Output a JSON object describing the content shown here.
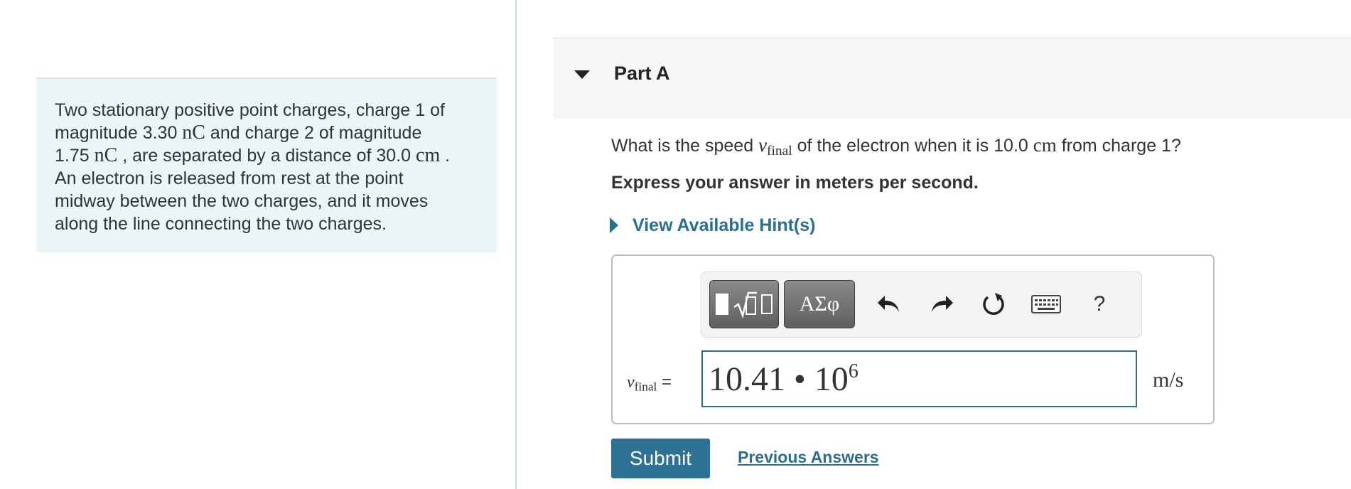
{
  "problem": {
    "line1": "Two stationary positive point charges, charge 1 of",
    "line2_a": "magnitude 3.30 ",
    "line2_unit": "nC",
    "line2_b": " and charge 2 of magnitude",
    "line3_a": "1.75 ",
    "line3_unit": "nC",
    "line3_b": " , are separated by a distance of 30.0 ",
    "line3_unit2": "cm",
    "line3_c": " .",
    "line4": "An electron is released from rest at the point",
    "line5": "midway between the two charges, and it moves",
    "line6": "along the line connecting the two charges."
  },
  "part": {
    "title": "Part A"
  },
  "question": {
    "text_a": "What is the speed ",
    "var_v": "v",
    "var_sub": "final",
    "text_b": " of the electron when it is 10.0 ",
    "unit": "cm",
    "text_c": " from charge 1?"
  },
  "instruction": "Express your answer in meters per second.",
  "hint": {
    "label": "View Available Hint(s)"
  },
  "toolbar": {
    "greek_label": "ΑΣφ",
    "help_label": "?"
  },
  "answer": {
    "var_v": "v",
    "var_sub": "final",
    "equals": " =",
    "value_mantissa": "10.41 • 10",
    "value_exponent": "6",
    "unit": "m/s"
  },
  "actions": {
    "submit_label": "Submit",
    "previous_answers_label": "Previous Answers"
  },
  "colors": {
    "accent": "#2a6f8f",
    "panel_bg": "#e9f5f7",
    "submit_bg": "#2e7194"
  }
}
